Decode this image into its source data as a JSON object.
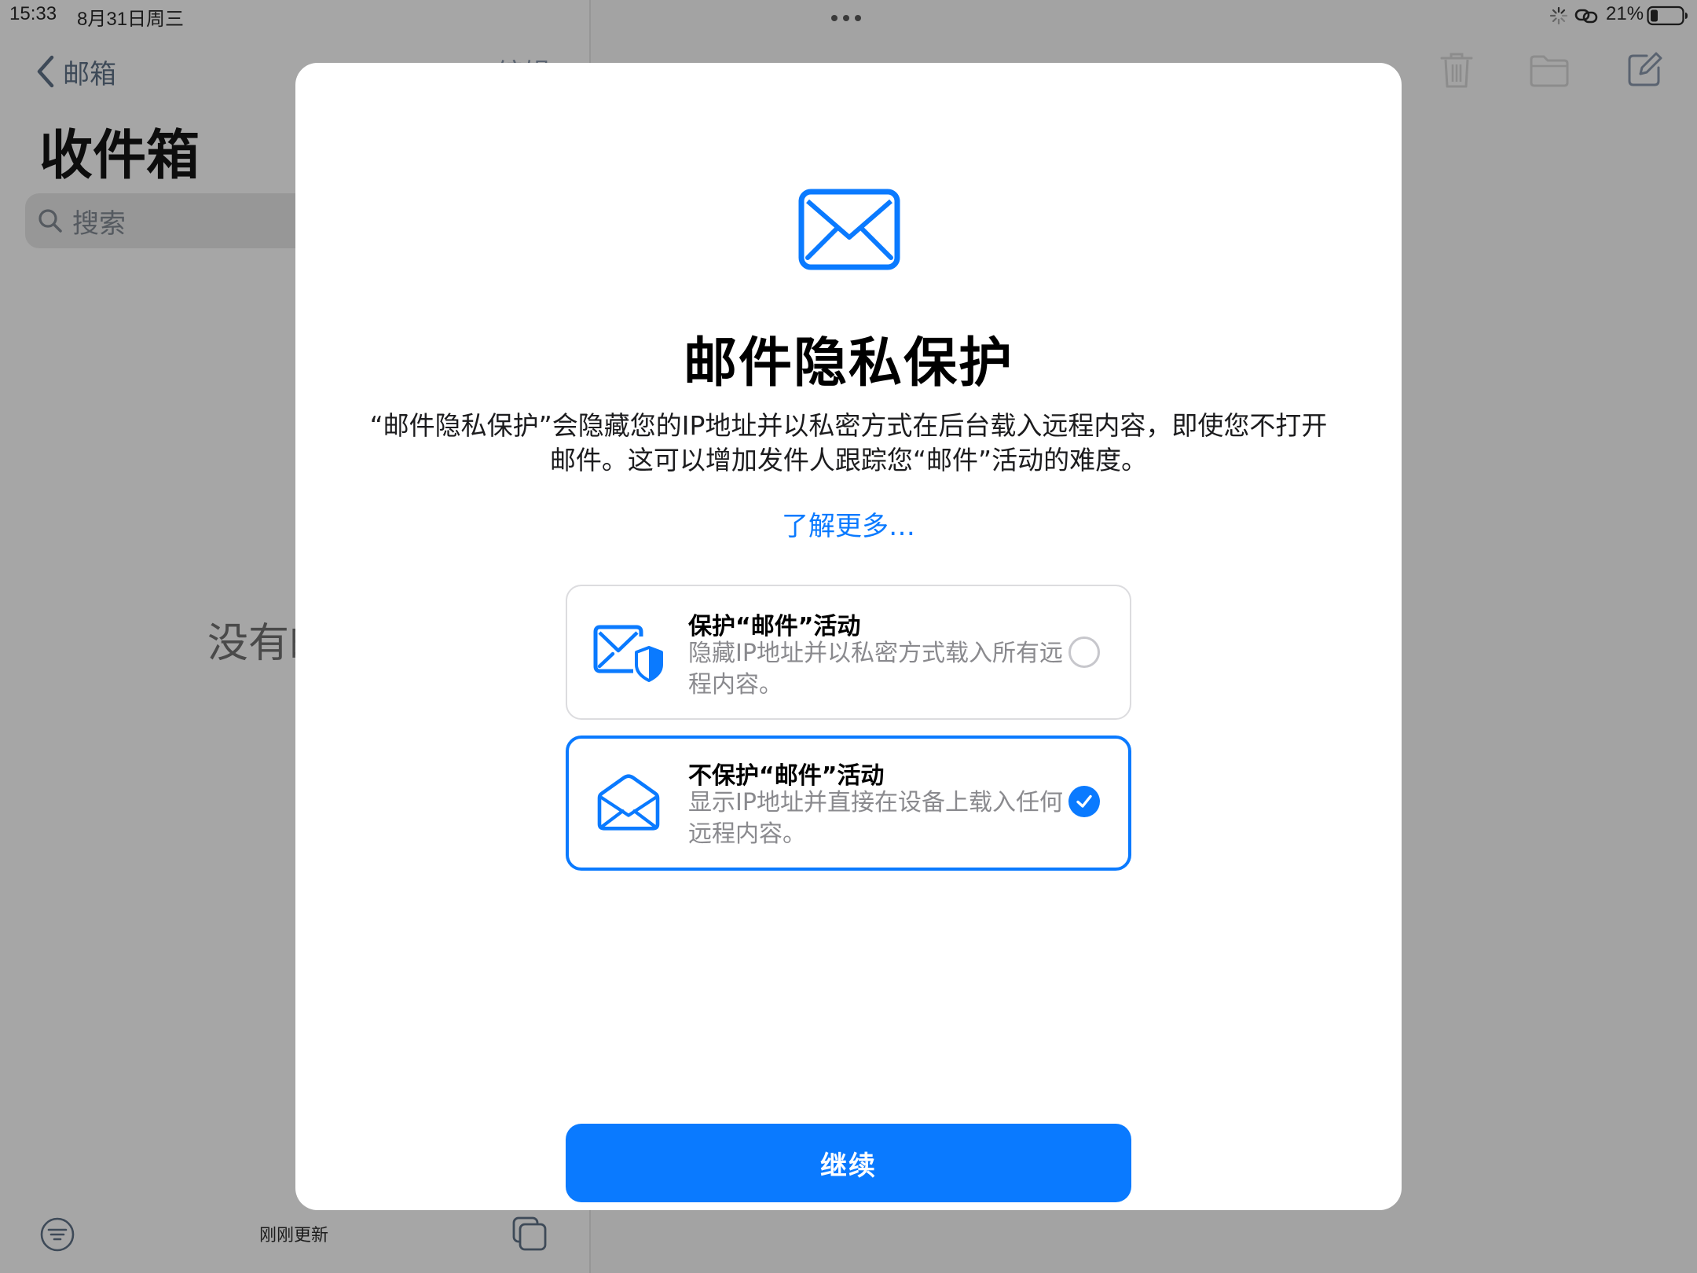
{
  "status_bar": {
    "time": "15:33",
    "date": "8月31日周三",
    "battery": "21%"
  },
  "sidebar": {
    "back_label": "邮箱",
    "edit_label": "编辑",
    "title": "收件箱",
    "search_placeholder": "搜索",
    "empty_text": "没有邮件",
    "updated_text": "刚刚更新"
  },
  "modal": {
    "title": "邮件隐私保护",
    "description": "“邮件隐私保护”会隐藏您的IP地址并以私密方式在后台载入远程内容，即使您不打开邮件。这可以增加发件人跟踪您“邮件”活动的难度。",
    "learn_more": "了解更多…",
    "options": [
      {
        "title": "保护“邮件”活动",
        "description": "隐藏IP地址并以私密方式载入所有远程内容。",
        "icon": "mail-shield-icon",
        "selected": false
      },
      {
        "title": "不保护“邮件”活动",
        "description": "显示IP地址并直接在设备上载入任何远程内容。",
        "icon": "open-envelope-icon",
        "selected": true
      }
    ],
    "continue_label": "继续"
  },
  "colors": {
    "accent": "#0a7aff",
    "overlay": "#a4a4a4"
  }
}
